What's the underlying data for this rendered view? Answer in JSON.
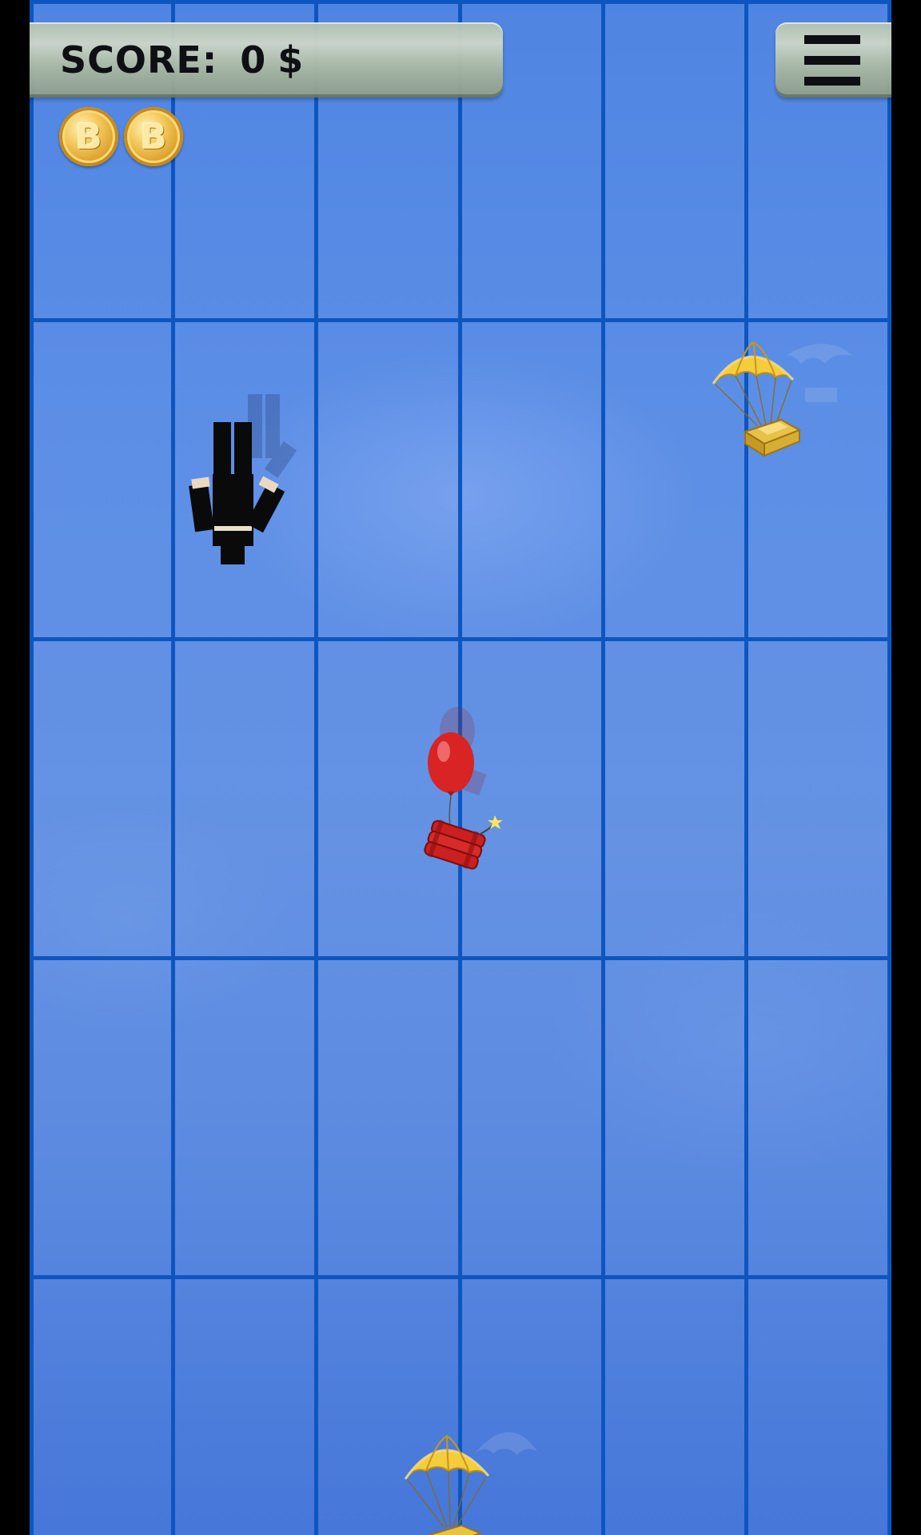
{
  "hud": {
    "score_label": "SCORE:",
    "score_value": "0",
    "score_unit": "$",
    "menu_icon": "hamburger-menu-icon"
  },
  "lives": {
    "coin_symbol": "B",
    "coin_count": 2,
    "coin_icon": "bitcoin-coin-icon"
  },
  "scene": {
    "objects": [
      "skydiver",
      "gold-parachute-drop",
      "balloon-dynamite",
      "gold-parachute-drop"
    ]
  },
  "colors": {
    "sky": "#5d8fe6",
    "grid": "#0d56c0",
    "panel": "#b5c2b0",
    "gold": "#f2c75a",
    "balloon": "#d82424",
    "dynamite": "#cc1f1f"
  }
}
